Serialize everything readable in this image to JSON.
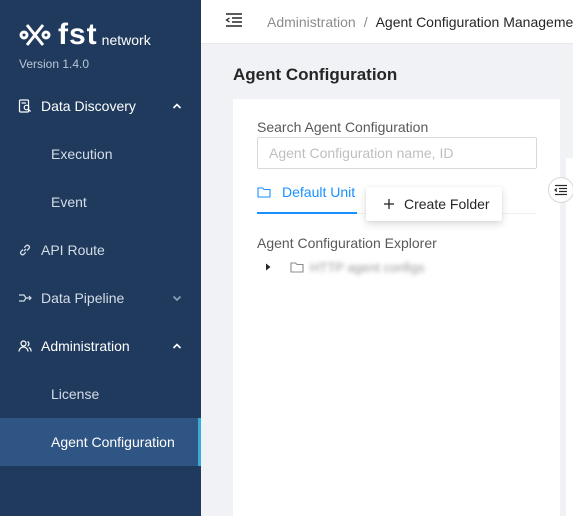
{
  "sidebar": {
    "logo_main": "fst",
    "logo_sub": "network",
    "version": "Version 1.4.0",
    "items": [
      {
        "label": "Data Discovery",
        "icon": "search-doc-icon",
        "expanded": true
      },
      {
        "label": "Execution"
      },
      {
        "label": "Event"
      },
      {
        "label": "API Route",
        "icon": "link-icon"
      },
      {
        "label": "Data Pipeline",
        "icon": "pipeline-icon",
        "expanded": false
      },
      {
        "label": "Administration",
        "icon": "user-group-icon",
        "expanded": true
      },
      {
        "label": "License"
      },
      {
        "label": "Agent Configuration",
        "active": true
      }
    ],
    "colors": {
      "background": "#1f3a5c",
      "active": "#2f5584",
      "accent": "#3aa9d6"
    }
  },
  "header": {
    "breadcrumb": [
      "Administration",
      "Agent Configuration Management"
    ],
    "separator": "/"
  },
  "main": {
    "title": "Agent Configuration",
    "search": {
      "label": "Search Agent Configuration",
      "placeholder": "Agent Configuration name, ID",
      "value": ""
    },
    "unit_tab": {
      "label": "Default Unit"
    },
    "context_menu": {
      "create_folder": "Create Folder"
    },
    "explorer": {
      "label": "Agent Configuration Explorer",
      "nodes": [
        {
          "label": "HTTP agent configs"
        }
      ]
    }
  }
}
